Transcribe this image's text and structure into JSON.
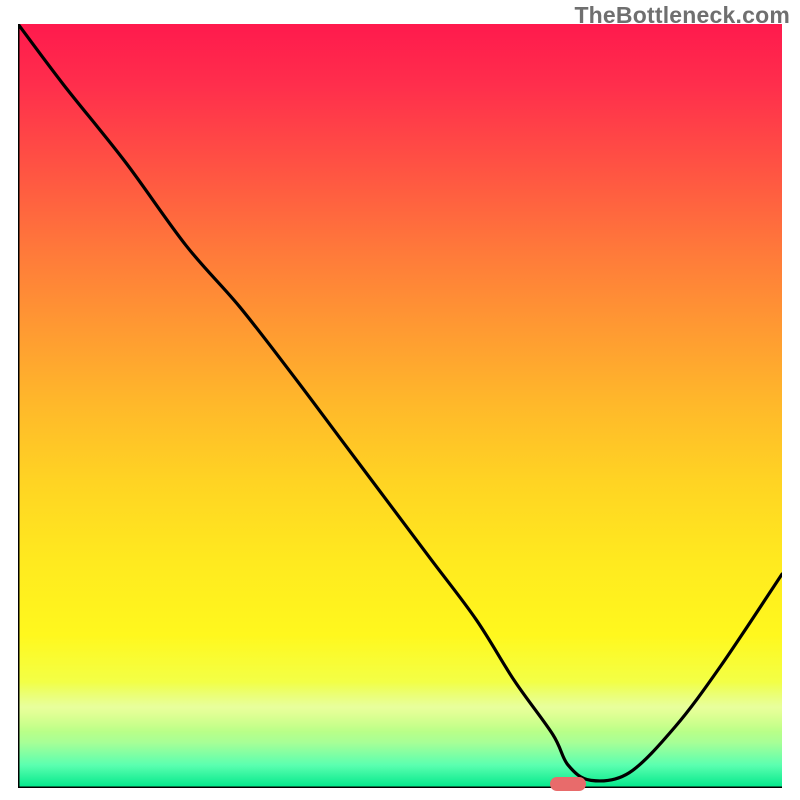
{
  "watermark": "TheBottleneck.com",
  "chart_data": {
    "type": "line",
    "title": "",
    "xlabel": "",
    "ylabel": "",
    "xlim": [
      0,
      100
    ],
    "ylim": [
      0,
      100
    ],
    "grid": false,
    "series": [
      {
        "name": "curve",
        "x": [
          0,
          6,
          14,
          22,
          29,
          36,
          42,
          48,
          54,
          60,
          65,
          70,
          72,
          75,
          80,
          86,
          92,
          100
        ],
        "values": [
          100,
          92,
          82,
          71,
          63,
          54,
          46,
          38,
          30,
          22,
          14,
          7,
          3,
          1,
          2,
          8,
          16,
          28
        ]
      }
    ],
    "marker": {
      "x": 72,
      "y": 0.5
    },
    "background_gradient": {
      "top": "#ff1a4d",
      "bottom": "#00e88a"
    }
  }
}
